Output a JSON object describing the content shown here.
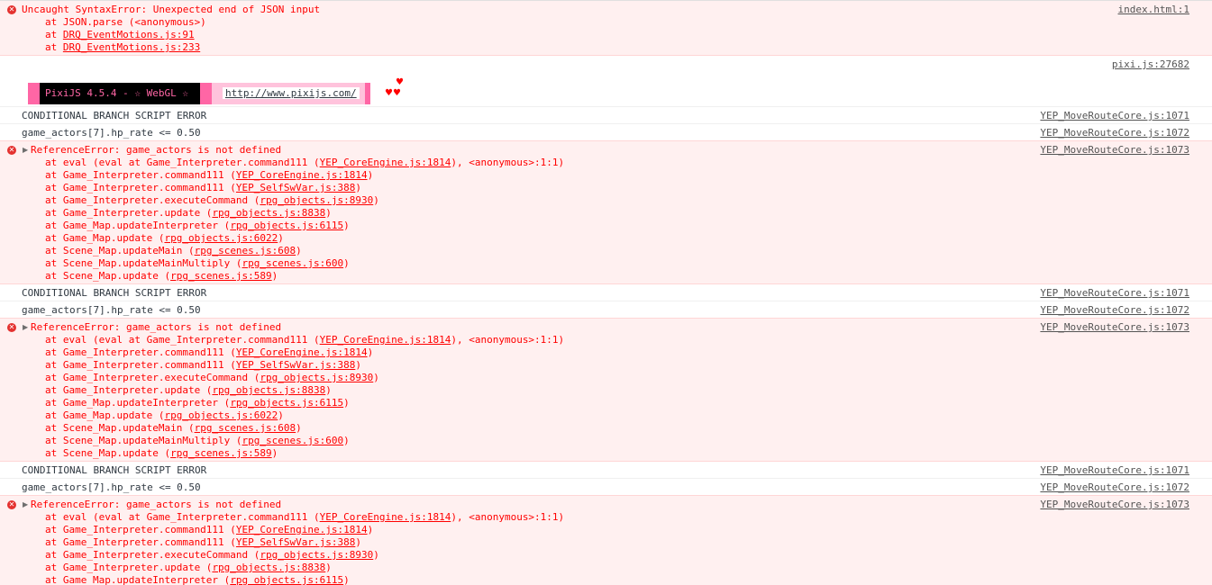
{
  "syntax_error": {
    "message": "Uncaught SyntaxError: Unexpected end of JSON input",
    "source": "index.html:1",
    "frames": [
      {
        "prefix": "at JSON.parse (<anonymous>)",
        "loc": "",
        "suffix": ""
      },
      {
        "prefix": "at ",
        "loc": "DRQ_EventMotions.js:91",
        "suffix": ""
      },
      {
        "prefix": "at ",
        "loc": "DRQ_EventMotions.js:233",
        "suffix": ""
      }
    ]
  },
  "pixi_banner": {
    "source": "pixi.js:27682",
    "label": "PixiJS 4.5.4 - ☆ WebGL ☆",
    "link": "http://www.pixijs.com/",
    "hearts": "♥",
    "hearts_double": "♥♥"
  },
  "groups": [
    {
      "branch_error": "CONDITIONAL BRANCH SCRIPT ERROR",
      "branch_source": "YEP_MoveRouteCore.js:1071",
      "condition": "game_actors[7].hp_rate <= 0.50",
      "condition_source": "YEP_MoveRouteCore.js:1072",
      "ref_error": "ReferenceError: game_actors is not defined",
      "ref_source": "YEP_MoveRouteCore.js:1073",
      "frames": [
        {
          "prefix": "at eval (eval at Game_Interpreter.command111 (",
          "loc": "YEP_CoreEngine.js:1814",
          "suffix": "), <anonymous>:1:1)"
        },
        {
          "prefix": "at Game_Interpreter.command111 (",
          "loc": "YEP_CoreEngine.js:1814",
          "suffix": ")"
        },
        {
          "prefix": "at Game_Interpreter.command111 (",
          "loc": "YEP_SelfSwVar.js:388",
          "suffix": ")"
        },
        {
          "prefix": "at Game_Interpreter.executeCommand (",
          "loc": "rpg_objects.js:8930",
          "suffix": ")"
        },
        {
          "prefix": "at Game_Interpreter.update (",
          "loc": "rpg_objects.js:8838",
          "suffix": ")"
        },
        {
          "prefix": "at Game_Map.updateInterpreter (",
          "loc": "rpg_objects.js:6115",
          "suffix": ")"
        },
        {
          "prefix": "at Game_Map.update (",
          "loc": "rpg_objects.js:6022",
          "suffix": ")"
        },
        {
          "prefix": "at Scene_Map.updateMain (",
          "loc": "rpg_scenes.js:608",
          "suffix": ")"
        },
        {
          "prefix": "at Scene_Map.updateMainMultiply (",
          "loc": "rpg_scenes.js:600",
          "suffix": ")"
        },
        {
          "prefix": "at Scene_Map.update (",
          "loc": "rpg_scenes.js:589",
          "suffix": ")"
        }
      ]
    },
    {
      "branch_error": "CONDITIONAL BRANCH SCRIPT ERROR",
      "branch_source": "YEP_MoveRouteCore.js:1071",
      "condition": "game_actors[7].hp_rate <= 0.50",
      "condition_source": "YEP_MoveRouteCore.js:1072",
      "ref_error": "ReferenceError: game_actors is not defined",
      "ref_source": "YEP_MoveRouteCore.js:1073",
      "frames": [
        {
          "prefix": "at eval (eval at Game_Interpreter.command111 (",
          "loc": "YEP_CoreEngine.js:1814",
          "suffix": "), <anonymous>:1:1)"
        },
        {
          "prefix": "at Game_Interpreter.command111 (",
          "loc": "YEP_CoreEngine.js:1814",
          "suffix": ")"
        },
        {
          "prefix": "at Game_Interpreter.command111 (",
          "loc": "YEP_SelfSwVar.js:388",
          "suffix": ")"
        },
        {
          "prefix": "at Game_Interpreter.executeCommand (",
          "loc": "rpg_objects.js:8930",
          "suffix": ")"
        },
        {
          "prefix": "at Game_Interpreter.update (",
          "loc": "rpg_objects.js:8838",
          "suffix": ")"
        },
        {
          "prefix": "at Game_Map.updateInterpreter (",
          "loc": "rpg_objects.js:6115",
          "suffix": ")"
        },
        {
          "prefix": "at Game_Map.update (",
          "loc": "rpg_objects.js:6022",
          "suffix": ")"
        },
        {
          "prefix": "at Scene_Map.updateMain (",
          "loc": "rpg_scenes.js:608",
          "suffix": ")"
        },
        {
          "prefix": "at Scene_Map.updateMainMultiply (",
          "loc": "rpg_scenes.js:600",
          "suffix": ")"
        },
        {
          "prefix": "at Scene_Map.update (",
          "loc": "rpg_scenes.js:589",
          "suffix": ")"
        }
      ]
    },
    {
      "branch_error": "CONDITIONAL BRANCH SCRIPT ERROR",
      "branch_source": "YEP_MoveRouteCore.js:1071",
      "condition": "game_actors[7].hp_rate <= 0.50",
      "condition_source": "YEP_MoveRouteCore.js:1072",
      "ref_error": "ReferenceError: game_actors is not defined",
      "ref_source": "YEP_MoveRouteCore.js:1073",
      "frames": [
        {
          "prefix": "at eval (eval at Game_Interpreter.command111 (",
          "loc": "YEP_CoreEngine.js:1814",
          "suffix": "), <anonymous>:1:1)"
        },
        {
          "prefix": "at Game_Interpreter.command111 (",
          "loc": "YEP_CoreEngine.js:1814",
          "suffix": ")"
        },
        {
          "prefix": "at Game_Interpreter.command111 (",
          "loc": "YEP_SelfSwVar.js:388",
          "suffix": ")"
        },
        {
          "prefix": "at Game_Interpreter.executeCommand (",
          "loc": "rpg_objects.js:8930",
          "suffix": ")"
        },
        {
          "prefix": "at Game_Interpreter.update (",
          "loc": "rpg_objects.js:8838",
          "suffix": ")"
        },
        {
          "prefix": "at Game_Map.updateInterpreter (",
          "loc": "rpg_objects.js:6115",
          "suffix": ")"
        }
      ]
    }
  ]
}
